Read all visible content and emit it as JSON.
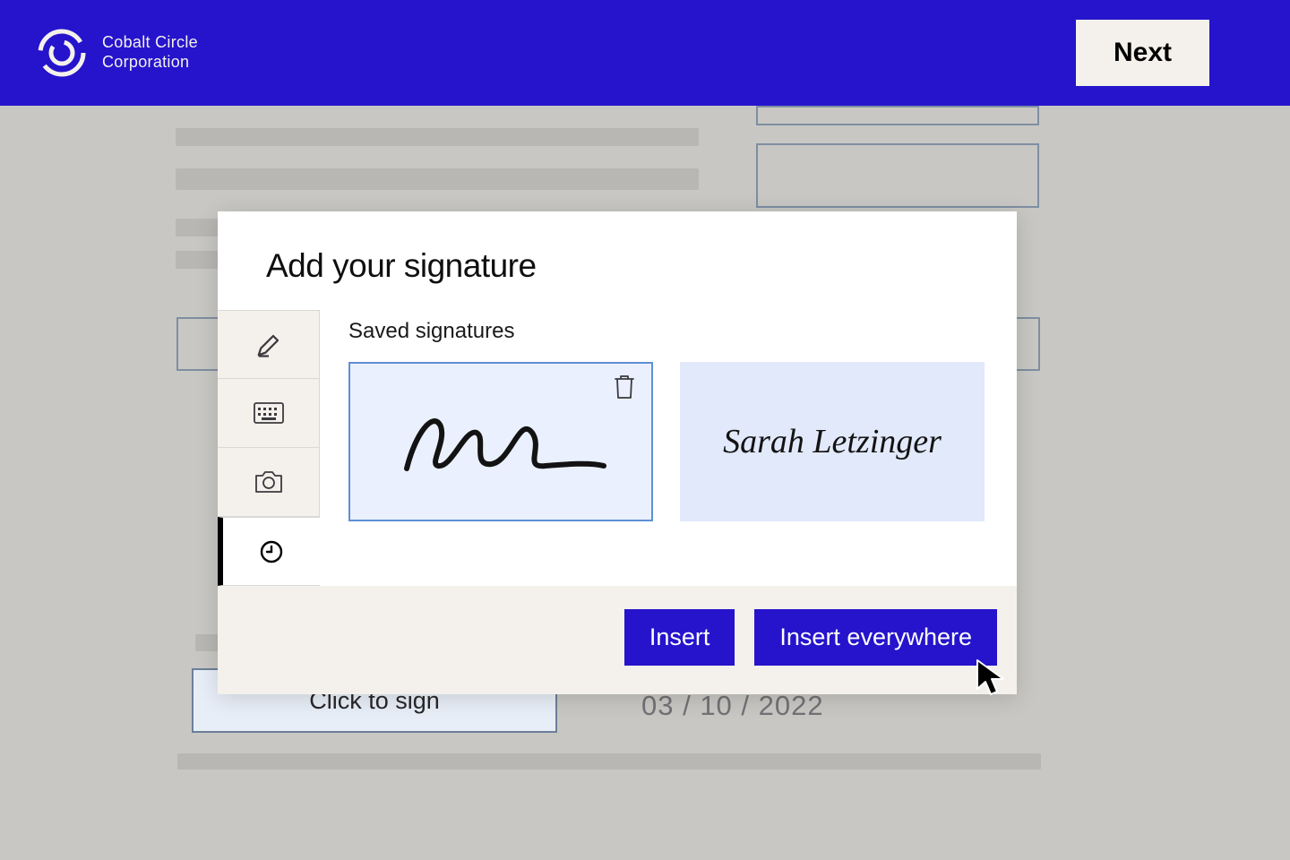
{
  "header": {
    "brand_line1": "Cobalt Circle",
    "brand_line2": "Corporation",
    "next_label": "Next"
  },
  "document": {
    "sign_field_label": "Click to sign",
    "date_value": "03 / 10 / 2022"
  },
  "modal": {
    "title": "Add your signature",
    "subtitle": "Saved signatures",
    "signatures": {
      "sig2_text": "Sarah Letzinger"
    },
    "buttons": {
      "insert": "Insert",
      "insert_everywhere": "Insert everywhere"
    },
    "tabs": {
      "draw": "draw-signature",
      "type": "type-signature",
      "photo": "photo-signature",
      "saved": "saved-signatures"
    }
  }
}
